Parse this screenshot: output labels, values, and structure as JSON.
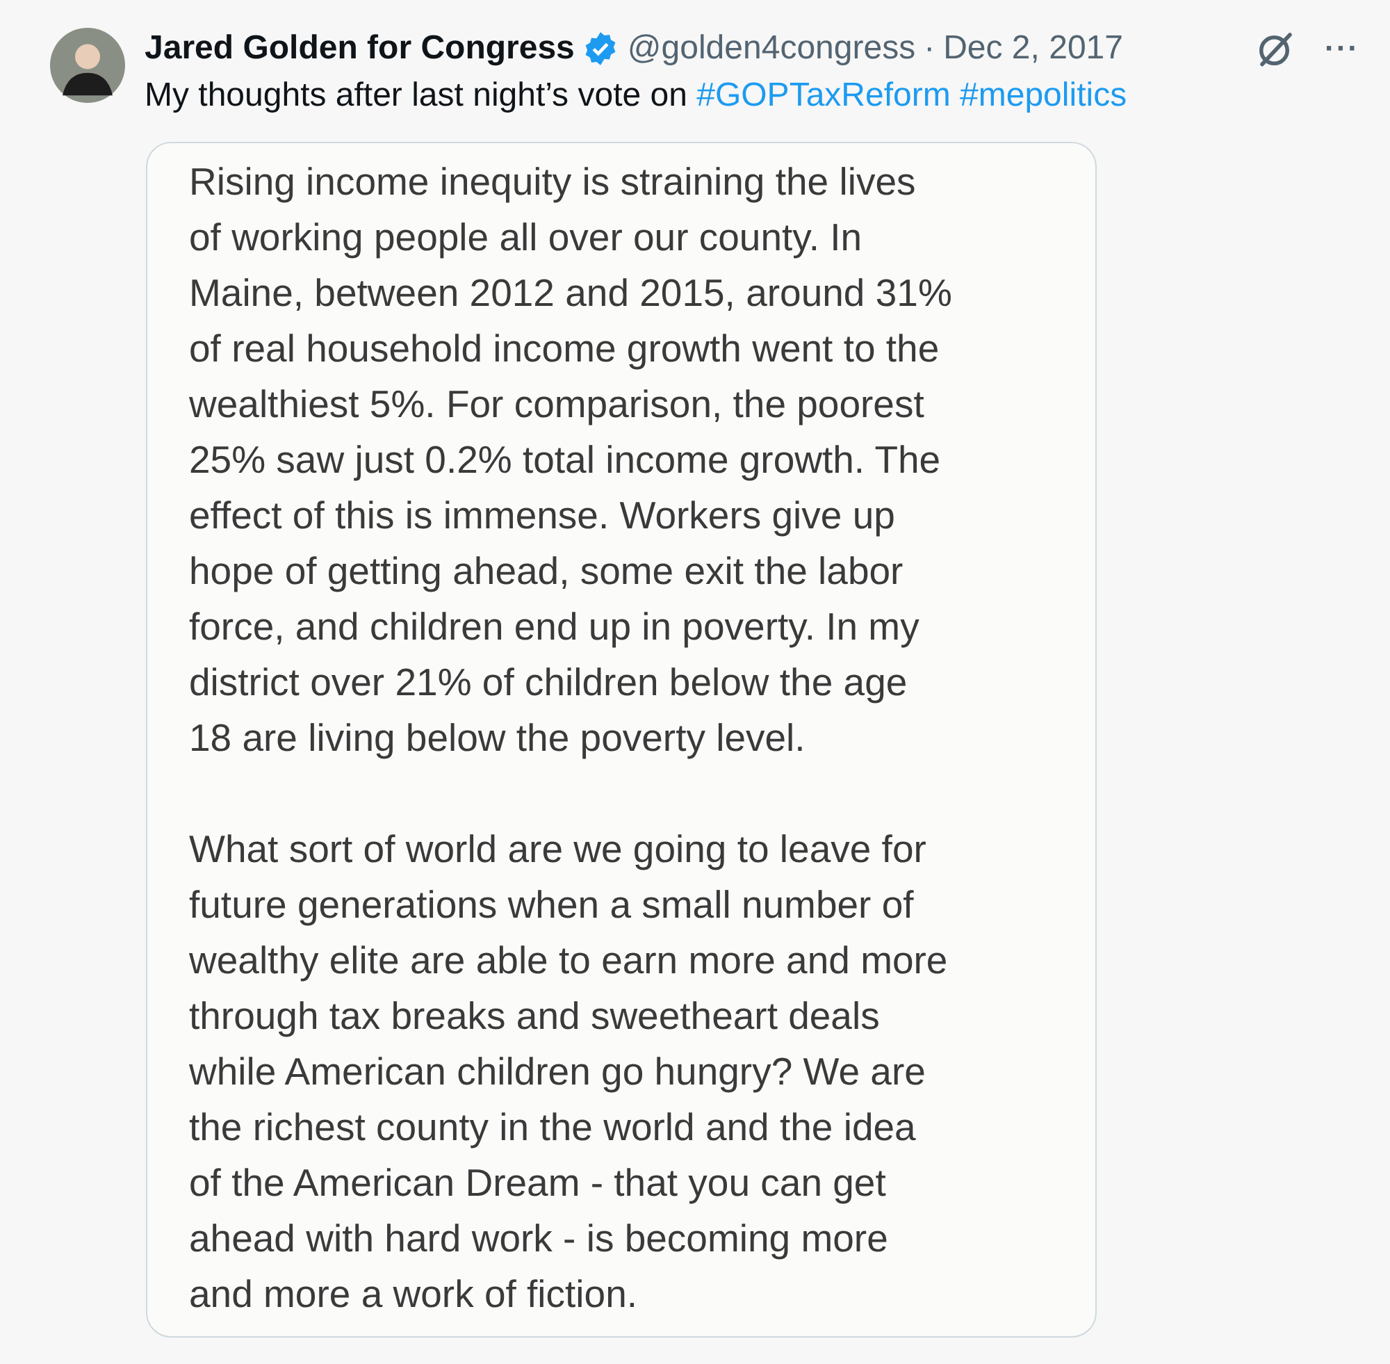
{
  "tweet": {
    "author": "Jared Golden for Congress",
    "verified": true,
    "handle": "@golden4congress",
    "separator": "·",
    "date": "Dec 2, 2017",
    "more": "···",
    "text": "My thoughts after last night’s vote on",
    "hashtags": [
      "#GOPTaxReform",
      "#mepolitics"
    ],
    "image": {
      "paragraphs": [
        [
          "Rising income inequity is straining the lives",
          "of working people all over our county. In",
          "Maine, between 2012 and 2015, around 31%",
          "of real household income growth went to the",
          "wealthiest 5%. For comparison, the poorest",
          "25% saw just 0.2% total income growth. The",
          "effect of this is immense. Workers give up",
          "hope of getting ahead, some exit the labor",
          "force, and children end up in poverty. In my",
          "district over 21% of children below the age",
          "18 are living below the poverty level."
        ],
        [
          "What sort of world are we going to leave for",
          "future generations when a small number of",
          "wealthy elite are able to earn more and more",
          "through tax breaks and sweetheart deals",
          "while American children go hungry? We are",
          "the richest county in the world and the idea",
          "of the American Dream - that you can get",
          "ahead with hard work - is becoming more",
          "and more a work of fiction."
        ]
      ]
    }
  }
}
